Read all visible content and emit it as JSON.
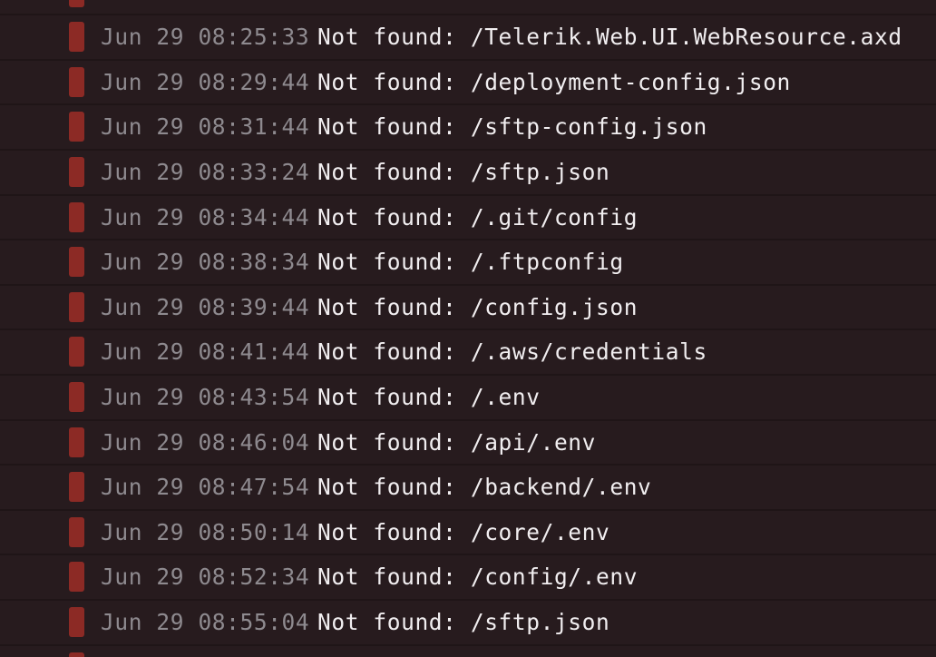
{
  "log": {
    "entries": [
      {
        "timestamp": "",
        "message": ""
      },
      {
        "timestamp": "Jun 29 08:25:33",
        "message": "Not found: /Telerik.Web.UI.WebResource.axd"
      },
      {
        "timestamp": "Jun 29 08:29:44",
        "message": "Not found: /deployment-config.json"
      },
      {
        "timestamp": "Jun 29 08:31:44",
        "message": "Not found: /sftp-config.json"
      },
      {
        "timestamp": "Jun 29 08:33:24",
        "message": "Not found: /sftp.json"
      },
      {
        "timestamp": "Jun 29 08:34:44",
        "message": "Not found: /.git/config"
      },
      {
        "timestamp": "Jun 29 08:38:34",
        "message": "Not found: /.ftpconfig"
      },
      {
        "timestamp": "Jun 29 08:39:44",
        "message": "Not found: /config.json"
      },
      {
        "timestamp": "Jun 29 08:41:44",
        "message": "Not found: /.aws/credentials"
      },
      {
        "timestamp": "Jun 29 08:43:54",
        "message": "Not found: /.env"
      },
      {
        "timestamp": "Jun 29 08:46:04",
        "message": "Not found: /api/.env"
      },
      {
        "timestamp": "Jun 29 08:47:54",
        "message": "Not found: /backend/.env"
      },
      {
        "timestamp": "Jun 29 08:50:14",
        "message": "Not found: /core/.env"
      },
      {
        "timestamp": "Jun 29 08:52:34",
        "message": "Not found: /config/.env"
      },
      {
        "timestamp": "Jun 29 08:55:04",
        "message": "Not found: /sftp.json"
      },
      {
        "timestamp": "",
        "message": ""
      }
    ]
  },
  "colors": {
    "background": "#1f1517",
    "row": "#271b1e",
    "error_marker": "#8c2a25",
    "timestamp_text": "#8e8a8f",
    "message_text": "#f1eef0"
  },
  "icons": {
    "row_marker": "error-marker-icon"
  }
}
